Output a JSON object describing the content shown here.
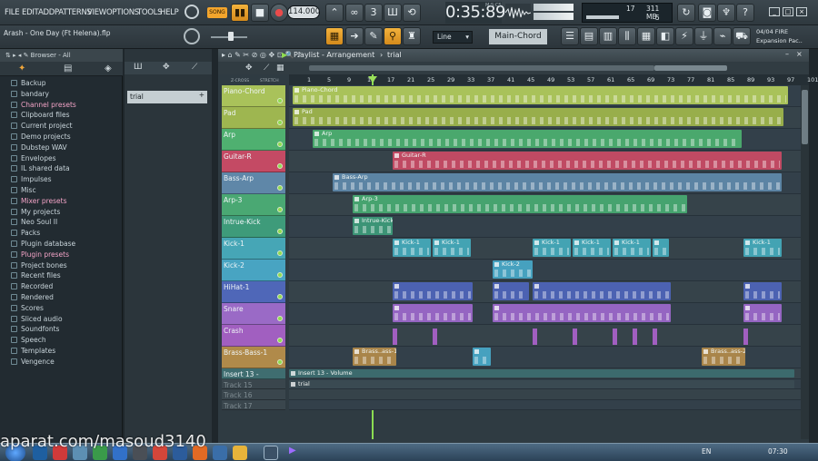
{
  "menu": [
    "FILE",
    "EDIT",
    "ADD",
    "PATTERNS",
    "VIEW",
    "OPTIONS",
    "TOOLS",
    "HELP"
  ],
  "file_hint": "Arash - One Day (Ft Helena).flp",
  "transport": {
    "song_label": "SONG",
    "tempo": "114.000",
    "time": "0:35:89",
    "time_unit": "M:S:CS"
  },
  "cpu": {
    "value": "17",
    "mem": "311 MB",
    "voices": "5"
  },
  "snap": {
    "line_label": "Line",
    "pattern": "Main-Chord"
  },
  "hint_panel": {
    "line1": "04/04  FIRE",
    "line2": "Expansion Pac.."
  },
  "browser": {
    "title": "Browser - All",
    "items": [
      {
        "label": "Backup",
        "highlight": false
      },
      {
        "label": "bandary",
        "highlight": false
      },
      {
        "label": "Channel presets",
        "highlight": true
      },
      {
        "label": "Clipboard files",
        "highlight": false
      },
      {
        "label": "Current project",
        "highlight": false
      },
      {
        "label": "Demo projects",
        "highlight": false
      },
      {
        "label": "Dubstep WAV",
        "highlight": false
      },
      {
        "label": "Envelopes",
        "highlight": false
      },
      {
        "label": "IL shared data",
        "highlight": false
      },
      {
        "label": "Impulses",
        "highlight": false
      },
      {
        "label": "Misc",
        "highlight": false
      },
      {
        "label": "Mixer presets",
        "highlight": true
      },
      {
        "label": "My projects",
        "highlight": false
      },
      {
        "label": "Neo Soul II",
        "highlight": false
      },
      {
        "label": "Packs",
        "highlight": false
      },
      {
        "label": "Plugin database",
        "highlight": false
      },
      {
        "label": "Plugin presets",
        "highlight": true
      },
      {
        "label": "Project bones",
        "highlight": false
      },
      {
        "label": "Recent files",
        "highlight": false
      },
      {
        "label": "Recorded",
        "highlight": false
      },
      {
        "label": "Rendered",
        "highlight": false
      },
      {
        "label": "Scores",
        "highlight": false
      },
      {
        "label": "Sliced audio",
        "highlight": false
      },
      {
        "label": "Soundfonts",
        "highlight": false
      },
      {
        "label": "Speech",
        "highlight": false
      },
      {
        "label": "Templates",
        "highlight": false
      },
      {
        "label": "Vengence",
        "highlight": false
      }
    ]
  },
  "channel_panel": {
    "pattern_name": "trial"
  },
  "playlist": {
    "title": "Playlist - Arrangement",
    "arrangement": "trial",
    "stretch_labels": [
      "Z-CROSS",
      "STRETCH"
    ],
    "ruler_ticks": [
      "1",
      "5",
      "9",
      "13",
      "17",
      "21",
      "25",
      "29",
      "33",
      "37",
      "41",
      "45",
      "49",
      "53",
      "57",
      "61",
      "65",
      "69",
      "73",
      "77",
      "81",
      "85",
      "89",
      "93",
      "97",
      "101"
    ],
    "tracks": [
      {
        "name": "Piano-Chord",
        "color": "#a9c25a"
      },
      {
        "name": "Pad",
        "color": "#9eb650"
      },
      {
        "name": "Arp",
        "color": "#4fb070"
      },
      {
        "name": "Guitar-R",
        "color": "#c44a64"
      },
      {
        "name": "Bass-Arp",
        "color": "#5f87a8"
      },
      {
        "name": "Arp-3",
        "color": "#4aa873"
      },
      {
        "name": "Intrue-Kick",
        "color": "#3e9b7a"
      },
      {
        "name": "Kick-1",
        "color": "#46a6b6"
      },
      {
        "name": "Kick-2",
        "color": "#48a4c2"
      },
      {
        "name": "HiHat-1",
        "color": "#4f67b8"
      },
      {
        "name": "Snare",
        "color": "#9a6ac6"
      },
      {
        "name": "Crash",
        "color": "#a15fc0"
      },
      {
        "name": "Brass-Bass-1",
        "color": "#b08a4a"
      },
      {
        "name": "Insert 13 - Volume",
        "color": "#3f6d70"
      },
      {
        "name": "Track 15",
        "color": "#3a464d"
      },
      {
        "name": "Track 16",
        "color": "#3a464d"
      },
      {
        "name": "Track 17",
        "color": "#3a464d"
      }
    ],
    "clip_labels": {
      "piano": "Piano-Chord",
      "pad": "Pad",
      "arp": "Arp",
      "guitar": "Guitar-R",
      "bassarp": "Bass-Arp",
      "arp3": "Arp-3",
      "intrue": "Intrue-Kick",
      "kick1": "Kick-1",
      "kick2": "Kick-2",
      "brass1": "Brass..ass-1",
      "brass2": "Brass..ass-2",
      "insert": "Insert 13 - Volume",
      "trial": "trial"
    }
  },
  "taskbar": {
    "lang": "EN",
    "clock": "07:30"
  },
  "watermark": "aparat.com/masoud3140"
}
